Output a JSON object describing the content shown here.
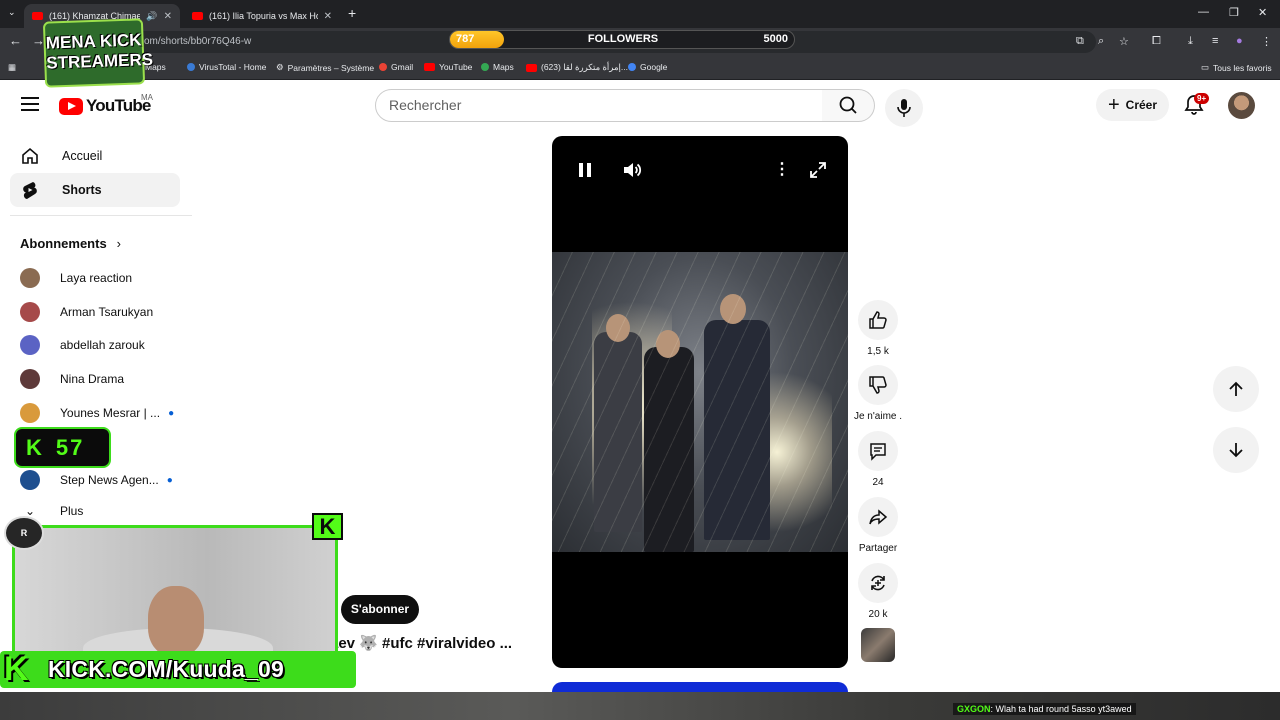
{
  "browser": {
    "tabs": [
      {
        "title": "(161) Khamzat Chimaev 🐺",
        "active": true
      },
      {
        "title": "(161) Ilia Topuria vs Max Hollow",
        "active": false
      }
    ],
    "url": "om/shorts/bb0r76Q46-w",
    "bookmarks": [
      "Maps",
      "VirusTotal - Home",
      "Paramètres – Système",
      "Gmail",
      "YouTube",
      "Maps",
      "(623) إمرأة متكررة لقا...",
      "Google"
    ],
    "all_bookmarks_label": "Tous les favoris"
  },
  "youtube": {
    "logo_text": "YouTube",
    "country_code": "MA",
    "search_placeholder": "Rechercher",
    "create_label": "Créer",
    "notification_badge": "9+",
    "sidebar": {
      "items": [
        {
          "label": "Accueil",
          "icon": "home-icon"
        },
        {
          "label": "Shorts",
          "icon": "shorts-icon",
          "active": true
        }
      ],
      "subscriptions_title": "Abonnements",
      "subscriptions": [
        {
          "name": "Laya reaction",
          "color": "#8a6b52"
        },
        {
          "name": "Arman Tsarukyan",
          "color": "#a64a4a"
        },
        {
          "name": "abdellah zarouk",
          "color": "#5b63c4"
        },
        {
          "name": "Nina Drama",
          "color": "#5e3a3a"
        },
        {
          "name": "Younes Mesrar | ...",
          "color": "#d99a3c",
          "live": true
        },
        {
          "name": "Step News Agen...",
          "color": "#1e4f8f",
          "live": true
        }
      ],
      "more_label": "Plus"
    },
    "short": {
      "subscribe_label": "S'abonner",
      "title": "aev 🐺 #ufc #viralvideo ...",
      "likes": "1,5 k",
      "dislike_label": "Je n'aime .",
      "comments": "24",
      "share_label": "Partager",
      "remix_count": "20 k"
    }
  },
  "stream_overlay": {
    "followers_current": "787",
    "followers_label": "FOLLOWERS",
    "followers_goal": "5000",
    "followers_progress": 0.157,
    "logo_text": "MENA KICK STREAMERS",
    "kick_counter": "57",
    "kick_url": "KICK.COM/Kuuda_09",
    "chat_user": "GXGON",
    "chat_text": ": Wlah ta had round 5asso yt3awed"
  },
  "colors": {
    "youtube_red": "#ff0000",
    "kick_green": "#53fc18",
    "live_blue": "#065fd4"
  }
}
